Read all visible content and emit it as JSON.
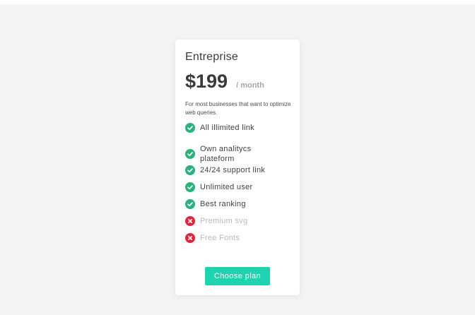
{
  "plan": {
    "name": "Entreprise",
    "price": "$199",
    "period": "/ month",
    "description": "For most businesses that want to optimize web queries."
  },
  "features": [
    {
      "label": "All illimited link",
      "included": true
    },
    {
      "label": "Own analitycs plateform",
      "included": true
    },
    {
      "label": "24/24 support link",
      "included": true
    },
    {
      "label": "Unlimited user",
      "included": true
    },
    {
      "label": "Best ranking",
      "included": true
    },
    {
      "label": "Premium svg",
      "included": false
    },
    {
      "label": "Free Fonts",
      "included": false
    }
  ],
  "action": {
    "label": "Choose plan"
  },
  "colors": {
    "accent": "#1fd2b0",
    "included": "#27b37a",
    "excluded": "#e5233a",
    "background": "#f4f4f4"
  },
  "icons": {
    "included": "check-circle-icon",
    "excluded": "x-circle-icon"
  }
}
